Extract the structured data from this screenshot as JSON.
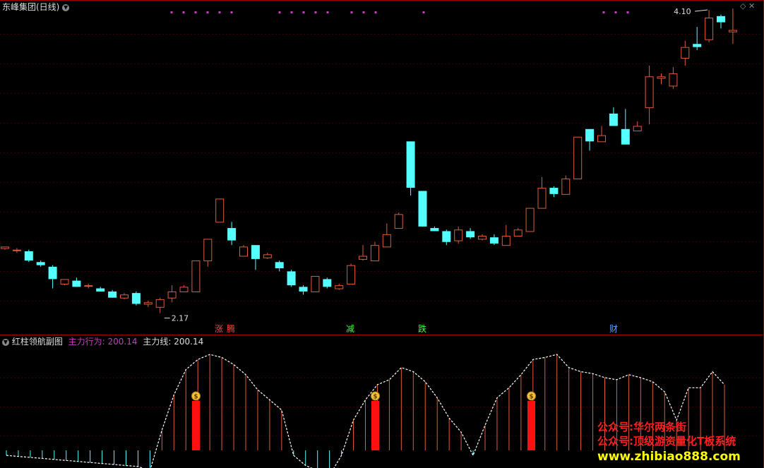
{
  "header": {
    "title": "东峰集团(日线)",
    "sub_title": "红柱领航副图",
    "label1": "主力行为: ",
    "value1": "200.14",
    "label2": "主力线: ",
    "value2": "200.14"
  },
  "colors": {
    "up": "#e05a3c",
    "down": "#54ffff",
    "frame": "#a00000",
    "gridline": "#3a0000",
    "purple": "#c040c0",
    "main_bar": "#ff1010"
  },
  "annotations": {
    "high_label": "4.10",
    "low_label": "2.17"
  },
  "signals": [
    {
      "text": "涨",
      "color": "#ff4040"
    },
    {
      "text": "腾",
      "color": "#ff4040"
    },
    {
      "text": "减",
      "color": "#40ff40"
    },
    {
      "text": "跌",
      "color": "#40ff40"
    },
    {
      "text": "财",
      "color": "#60a0ff"
    }
  ],
  "watermark": {
    "line1": "公众号:华尔两条街",
    "line2": "公众号:顶级游资量化T板系统",
    "line3": "www.zhibiao888.com"
  },
  "chart_data": {
    "type": "candlestick",
    "candles": [
      [
        2.61,
        2.62,
        2.6,
        2.62
      ],
      [
        2.6,
        2.6,
        2.58,
        2.61
      ],
      [
        2.59,
        2.53,
        2.52,
        2.6
      ],
      [
        2.52,
        2.5,
        2.49,
        2.53
      ],
      [
        2.49,
        2.41,
        2.35,
        2.5
      ],
      [
        2.38,
        2.41,
        2.37,
        2.41
      ],
      [
        2.4,
        2.36,
        2.36,
        2.42
      ],
      [
        2.37,
        2.37,
        2.35,
        2.38
      ],
      [
        2.35,
        2.33,
        2.33,
        2.36
      ],
      [
        2.33,
        2.29,
        2.29,
        2.34
      ],
      [
        2.29,
        2.31,
        2.28,
        2.32
      ],
      [
        2.32,
        2.25,
        2.24,
        2.33
      ],
      [
        2.25,
        2.26,
        2.23,
        2.27
      ],
      [
        2.23,
        2.28,
        2.19,
        2.29
      ],
      [
        2.29,
        2.33,
        2.26,
        2.37
      ],
      [
        2.33,
        2.36,
        2.33,
        2.37
      ],
      [
        2.33,
        2.53,
        2.33,
        2.53
      ],
      [
        2.53,
        2.67,
        2.49,
        2.67
      ],
      [
        2.78,
        2.93,
        2.78,
        2.93
      ],
      [
        2.74,
        2.66,
        2.63,
        2.78
      ],
      [
        2.56,
        2.62,
        2.56,
        2.63
      ],
      [
        2.63,
        2.54,
        2.47,
        2.63
      ],
      [
        2.55,
        2.57,
        2.54,
        2.58
      ],
      [
        2.52,
        2.48,
        2.46,
        2.53
      ],
      [
        2.46,
        2.37,
        2.36,
        2.47
      ],
      [
        2.36,
        2.33,
        2.31,
        2.37
      ],
      [
        2.33,
        2.43,
        2.33,
        2.43
      ],
      [
        2.41,
        2.36,
        2.35,
        2.42
      ],
      [
        2.35,
        2.37,
        2.34,
        2.38
      ],
      [
        2.38,
        2.5,
        2.38,
        2.51
      ],
      [
        2.54,
        2.56,
        2.53,
        2.63
      ],
      [
        2.53,
        2.63,
        2.53,
        2.65
      ],
      [
        2.62,
        2.7,
        2.62,
        2.77
      ],
      [
        2.74,
        2.83,
        2.74,
        2.84
      ],
      [
        3.3,
        3.0,
        2.95,
        3.3
      ],
      [
        2.98,
        2.75,
        2.75,
        2.98
      ],
      [
        2.74,
        2.72,
        2.72,
        2.75
      ],
      [
        2.72,
        2.65,
        2.63,
        2.73
      ],
      [
        2.66,
        2.73,
        2.64,
        2.75
      ],
      [
        2.72,
        2.68,
        2.67,
        2.74
      ],
      [
        2.67,
        2.69,
        2.66,
        2.7
      ],
      [
        2.68,
        2.64,
        2.63,
        2.7
      ],
      [
        2.63,
        2.69,
        2.63,
        2.76
      ],
      [
        2.69,
        2.73,
        2.69,
        2.74
      ],
      [
        2.72,
        2.87,
        2.72,
        2.87
      ],
      [
        2.87,
        3.0,
        2.87,
        3.07
      ],
      [
        3.0,
        2.96,
        2.94,
        3.01
      ],
      [
        2.96,
        3.06,
        2.96,
        3.08
      ],
      [
        3.06,
        3.33,
        3.06,
        3.33
      ],
      [
        3.38,
        3.3,
        3.24,
        3.38
      ],
      [
        3.3,
        3.34,
        3.3,
        3.4
      ],
      [
        3.48,
        3.4,
        3.4,
        3.52
      ],
      [
        3.38,
        3.28,
        3.28,
        3.51
      ],
      [
        3.37,
        3.4,
        3.37,
        3.43
      ],
      [
        3.52,
        3.72,
        3.41,
        3.79
      ],
      [
        3.71,
        3.72,
        3.67,
        3.74
      ],
      [
        3.66,
        3.74,
        3.64,
        3.78
      ],
      [
        3.84,
        3.91,
        3.79,
        3.95
      ],
      [
        3.93,
        3.91,
        3.89,
        4.04
      ],
      [
        3.96,
        4.1,
        3.94,
        4.15
      ],
      [
        4.11,
        4.07,
        4.03,
        4.12
      ],
      [
        4.01,
        4.02,
        3.93,
        4.16
      ]
    ],
    "price_axis_approx": [
      2.17,
      4.1
    ],
    "indicator": {
      "name": "主力行为",
      "values": [
        -5,
        -6,
        -7,
        -8,
        -9,
        -10,
        -11,
        -12,
        -13,
        -14,
        -15,
        -16,
        -20,
        20,
        55,
        80,
        90,
        95,
        92,
        85,
        75,
        60,
        50,
        40,
        -5,
        -15,
        -20,
        -25,
        -5,
        30,
        50,
        65,
        70,
        82,
        78,
        68,
        52,
        32,
        18,
        -5,
        25,
        52,
        62,
        75,
        90,
        92,
        95,
        82,
        78,
        76,
        72,
        70,
        75,
        72,
        68,
        58,
        30,
        62,
        62,
        78,
        65
      ]
    }
  }
}
